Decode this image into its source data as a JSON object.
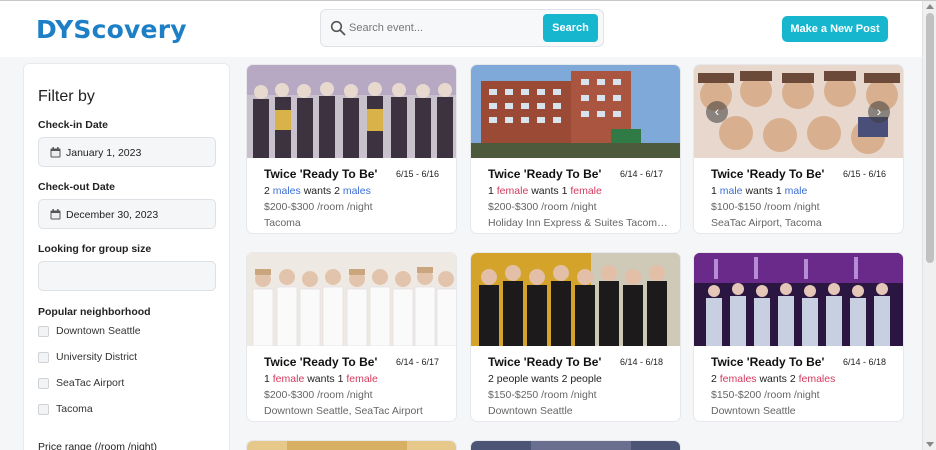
{
  "app": {
    "logo": "DYScovery"
  },
  "search": {
    "placeholder": "Search event...",
    "button": "Search"
  },
  "header": {
    "new_post": "Make a New Post"
  },
  "sidebar": {
    "title": "Filter by",
    "checkin_label": "Check-in Date",
    "checkin_value": "January 1, 2023",
    "checkout_label": "Check-out Date",
    "checkout_value": "December 30, 2023",
    "group_label": "Looking for group size",
    "group_value": "",
    "neighborhood_label": "Popular neighborhood",
    "neighborhoods": [
      "Downtown Seattle",
      "University District",
      "SeaTac Airport",
      "Tacoma"
    ],
    "price_label": "Price range (/room /night)"
  },
  "colors": {
    "accent": "#17b6cf",
    "logo": "#1d7fc6",
    "male": "#3b6fd6",
    "female": "#d23a5e"
  },
  "cards": [
    {
      "title": "Twice 'Ready To Be'",
      "dates": "6/15 - 6/16",
      "w1": "2",
      "w2": "males",
      "w3": "wants",
      "w4": "2",
      "w5": "males",
      "price": "$200-$300 /room /night",
      "location": "Tacoma"
    },
    {
      "title": "Twice 'Ready To Be'",
      "dates": "6/14 - 6/17",
      "w1": "1",
      "w2": "female",
      "w3": "wants",
      "w4": "1",
      "w5": "female",
      "price": "$200-$300 /room /night",
      "location": "Holiday Inn Express & Suites Tacoma..."
    },
    {
      "title": "Twice 'Ready To Be'",
      "dates": "6/15 - 6/16",
      "w1": "1",
      "w2": "male",
      "w3": "wants",
      "w4": "1",
      "w5": "male",
      "price": "$100-$150 /room /night",
      "location": "SeaTac Airport, Tacoma"
    },
    {
      "title": "Twice 'Ready To Be'",
      "dates": "6/14 - 6/17",
      "w1": "1",
      "w2": "female",
      "w3": "wants",
      "w4": "1",
      "w5": "female",
      "price": "$200-$300 /room /night",
      "location": "Downtown Seattle, SeaTac Airport"
    },
    {
      "title": "Twice 'Ready To Be'",
      "dates": "6/14 - 6/18",
      "w1": "2",
      "w2": "people",
      "w3": "wants",
      "w4": "2",
      "w5": "people",
      "price": "$150-$250 /room /night",
      "location": "Downtown Seattle"
    },
    {
      "title": "Twice 'Ready To Be'",
      "dates": "6/14 - 6/18",
      "w1": "2",
      "w2": "females",
      "w3": "wants",
      "w4": "2",
      "w5": "females",
      "price": "$150-$200 /room /night",
      "location": "Downtown Seattle"
    }
  ]
}
